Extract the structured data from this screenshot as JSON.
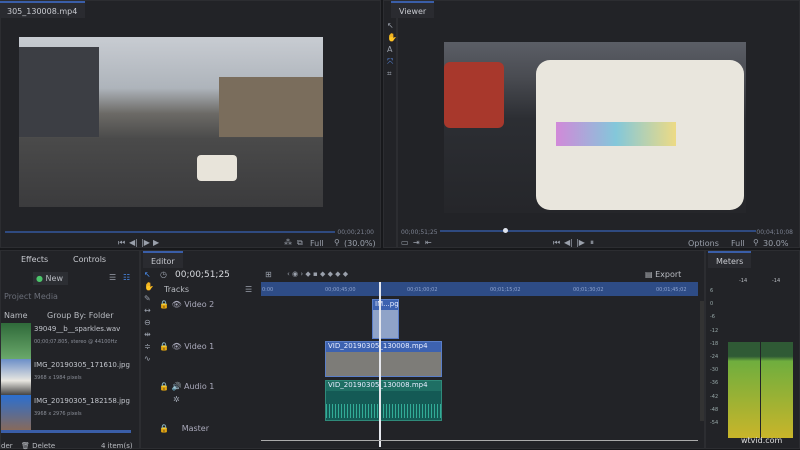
{
  "left_viewer": {
    "tab": "305_130008.mp4",
    "end_time": "00;00;21;00",
    "quality": "Full",
    "zoom": "(30.0%)",
    "progress": 0.0
  },
  "viewer": {
    "tab": "Viewer",
    "current_time": "00;00;51;25",
    "end_time": "00;04;10;08",
    "options": "Options",
    "quality": "Full",
    "zoom": "30.0%",
    "progress": 0.2
  },
  "media_panel": {
    "tabs": [
      "Effects",
      "Controls"
    ],
    "new_label": "New",
    "search_placeholder": "Project Media",
    "sort": "Name",
    "group_by": "Group By: Folder",
    "items": [
      {
        "name": "39049__b__sparkles.wav",
        "info": "00;00;07.805, stereo @ 44100Hz"
      },
      {
        "name": "IMG_20190305_171610.jpg",
        "info": "3968 x 1984 pixels"
      },
      {
        "name": "IMG_20190305_182158.jpg",
        "info": "3968 x 2976 pixels"
      }
    ],
    "delete_label": "Delete",
    "folder_label": "der",
    "count": "4 item(s)"
  },
  "editor": {
    "tab": "Editor",
    "timecode": "00;00;51;25",
    "tracks_label": "Tracks",
    "export_label": "Export",
    "ruler": [
      "0:00",
      "00;00;45;00",
      "00;01;00;02",
      "00;01;15;02",
      "00;01;30;02",
      "00;01;45;02"
    ],
    "tracks": [
      "Video 2",
      "Video 1",
      "Audio 1",
      "Master"
    ],
    "clips": {
      "image": "IM...pg",
      "video": "VID_20190305_130008.mp4",
      "audio": "VID_20190305_130008.mp4"
    }
  },
  "meters": {
    "tab": "Meters",
    "peaks": [
      "-14",
      "-14"
    ],
    "scale": [
      "6",
      "0",
      "-6",
      "-12",
      "-18",
      "-24",
      "-30",
      "-36",
      "-42",
      "-48",
      "-54"
    ],
    "level_db": -17
  },
  "watermark": "wtvid.com"
}
